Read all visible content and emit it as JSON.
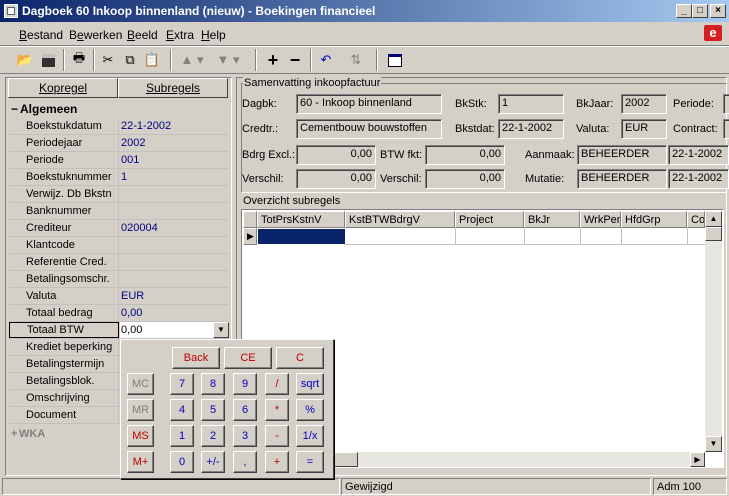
{
  "window": {
    "title": "Dagboek 60 Inkoop binnenland (nieuw) - Boekingen financieel"
  },
  "menu": [
    {
      "label": "Bestand",
      "u": "B",
      "rest": "estand"
    },
    {
      "label": "Bewerken",
      "u": "e",
      "pre": "B",
      "rest": "werken"
    },
    {
      "label": "Beeld",
      "u": "B",
      "rest": "eeld"
    },
    {
      "label": "Extra",
      "u": "E",
      "rest": "xtra"
    },
    {
      "label": "Help",
      "u": "H",
      "rest": "elp"
    }
  ],
  "left": {
    "tabs": [
      "Kopregel",
      "Subregels"
    ],
    "section": "Algemeen",
    "rows": [
      {
        "k": "Boekstukdatum",
        "v": "22-1-2002"
      },
      {
        "k": "Periodejaar",
        "v": "2002"
      },
      {
        "k": "Periode",
        "v": "001"
      },
      {
        "k": "Boekstuknummer",
        "v": "1"
      },
      {
        "k": "Verwijz. Db Bkstn",
        "v": ""
      },
      {
        "k": "Banknummer",
        "v": ""
      },
      {
        "k": "Crediteur",
        "v": "020004"
      },
      {
        "k": "Klantcode",
        "v": ""
      },
      {
        "k": "Referentie Cred.",
        "v": ""
      },
      {
        "k": "Betalingsomschr.",
        "v": ""
      },
      {
        "k": "Valuta",
        "v": "EUR"
      },
      {
        "k": "Totaal bedrag",
        "v": "0,00"
      },
      {
        "k": "Totaal BTW",
        "v": "0,00"
      },
      {
        "k": "Krediet beperking",
        "v": ""
      },
      {
        "k": "Betalingstermijn",
        "v": ""
      },
      {
        "k": "Betalingsblok.",
        "v": ""
      },
      {
        "k": "Omschrijving",
        "v": ""
      },
      {
        "k": "Document",
        "v": ""
      }
    ],
    "section2": "WKA"
  },
  "summary": {
    "legend": "Samenvatting inkoopfactuur",
    "dagbk_label": "Dagbk:",
    "dagbk": "60 - Inkoop binnenland",
    "bkstk_label": "BkStk:",
    "bkstk": "1",
    "bkjaar_label": "BkJaar:",
    "bkjaar": "2002",
    "periode_label": "Periode:",
    "periode": "",
    "credtr_label": "Credtr.:",
    "credtr": "Cementbouw bouwstoffen",
    "bkstdat_label": "Bkstdat:",
    "bkstdat": "22-1-2002",
    "valuta_label": "Valuta:",
    "valuta": "EUR",
    "contract_label": "Contract:",
    "contract": "",
    "bdrg_label": "Bdrg Excl.:",
    "bdrg": "0,00",
    "btwfkt_label": "BTW fkt:",
    "btwfkt": "0,00",
    "aanmaak_label": "Aanmaak:",
    "aanmaak_user": "BEHEERDER",
    "aanmaak_date": "22-1-2002",
    "verschil_label": "Verschil:",
    "verschil1": "0,00",
    "verschil2_label": "Verschil:",
    "verschil2": "0,00",
    "mutatie_label": "Mutatie:",
    "mutatie_user": "BEHEERDER",
    "mutatie_date": "22-1-2002"
  },
  "overview": {
    "legend": "Overzicht subregels",
    "columns": [
      "TotPrsKstnV",
      "KstBTWBdrgV",
      "Project",
      "BkJr",
      "WrkPer",
      "HfdGrp",
      "Coc"
    ]
  },
  "calc": {
    "top": [
      "Back",
      "CE",
      "C"
    ],
    "rows": [
      [
        "MC",
        "7",
        "8",
        "9",
        "/",
        "sqrt"
      ],
      [
        "MR",
        "4",
        "5",
        "6",
        "*",
        "%"
      ],
      [
        "MS",
        "1",
        "2",
        "3",
        "-",
        "1/x"
      ],
      [
        "M+",
        "0",
        "+/-",
        ",",
        "+",
        "="
      ]
    ]
  },
  "status": {
    "p1": "Gewijzigd",
    "p2": "Adm 100"
  }
}
